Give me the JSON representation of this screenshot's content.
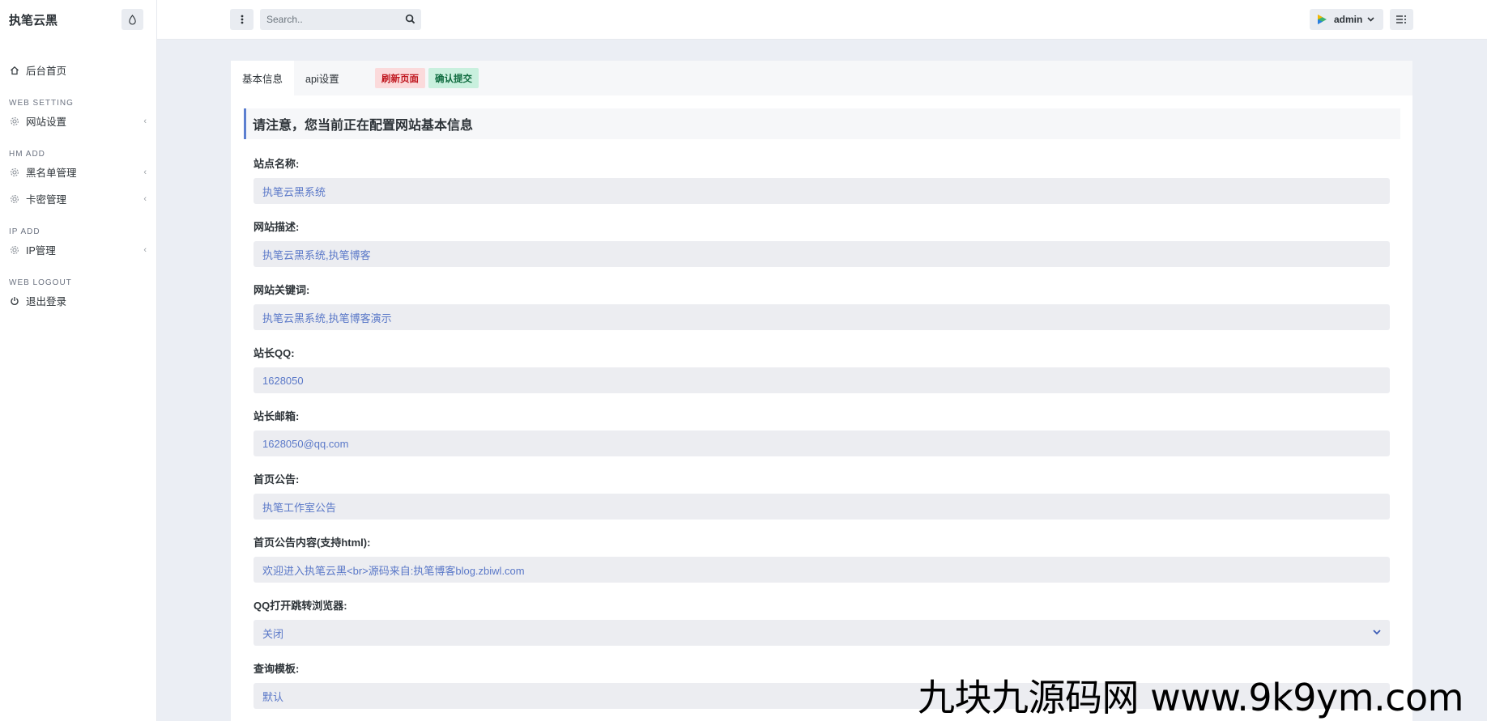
{
  "sidebar": {
    "brand": "执笔云黑",
    "items": [
      {
        "type": "item",
        "label": "后台首页",
        "icon": "home-icon",
        "has_chevron": false
      },
      {
        "type": "heading",
        "label": "WEB SETTING"
      },
      {
        "type": "item",
        "label": "网站设置",
        "icon": "gear-icon",
        "has_chevron": true
      },
      {
        "type": "heading",
        "label": "HM ADD"
      },
      {
        "type": "item",
        "label": "黑名单管理",
        "icon": "gear-icon",
        "has_chevron": true
      },
      {
        "type": "item",
        "label": "卡密管理",
        "icon": "gear-icon",
        "has_chevron": true
      },
      {
        "type": "heading",
        "label": "IP ADD"
      },
      {
        "type": "item",
        "label": "IP管理",
        "icon": "gear-icon",
        "has_chevron": true
      },
      {
        "type": "heading",
        "label": "WEB LOGOUT"
      },
      {
        "type": "item",
        "label": "退出登录",
        "icon": "power-icon",
        "has_chevron": false
      }
    ],
    "chevron": "‹"
  },
  "topbar": {
    "search_placeholder": "Search..",
    "user": "admin"
  },
  "tabs": [
    {
      "label": "基本信息",
      "active": true
    },
    {
      "label": "api设置",
      "active": false
    }
  ],
  "actions": {
    "refresh": "刷新页面",
    "submit": "确认提交"
  },
  "notice": "请注意，您当前正在配置网站基本信息",
  "fields": [
    {
      "label": "站点名称:",
      "value": "执笔云黑系统",
      "select": false
    },
    {
      "label": "网站描述:",
      "value": "执笔云黑系统,执笔博客",
      "select": false
    },
    {
      "label": "网站关键词:",
      "value": "执笔云黑系统,执笔博客演示",
      "select": false
    },
    {
      "label": "站长QQ:",
      "value": "1628050",
      "select": false
    },
    {
      "label": "站长邮箱:",
      "value": "1628050@qq.com",
      "select": false
    },
    {
      "label": "首页公告:",
      "value": "执笔工作室公告",
      "select": false
    },
    {
      "label": "首页公告内容(支持html):",
      "value": "欢迎进入执笔云黑<br>源码来自:执笔博客blog.zbiwl.com",
      "select": false
    },
    {
      "label": "QQ打开跳转浏览器:",
      "value": "关闭",
      "select": true
    },
    {
      "label": "查询模板:",
      "value": "默认",
      "select": false
    }
  ],
  "watermark": "九块九源码网 www.9k9ym.com",
  "colors": {
    "accent": "#5c7fd0",
    "danger_bg": "#fbdadb",
    "success_bg": "#c9f0de"
  }
}
